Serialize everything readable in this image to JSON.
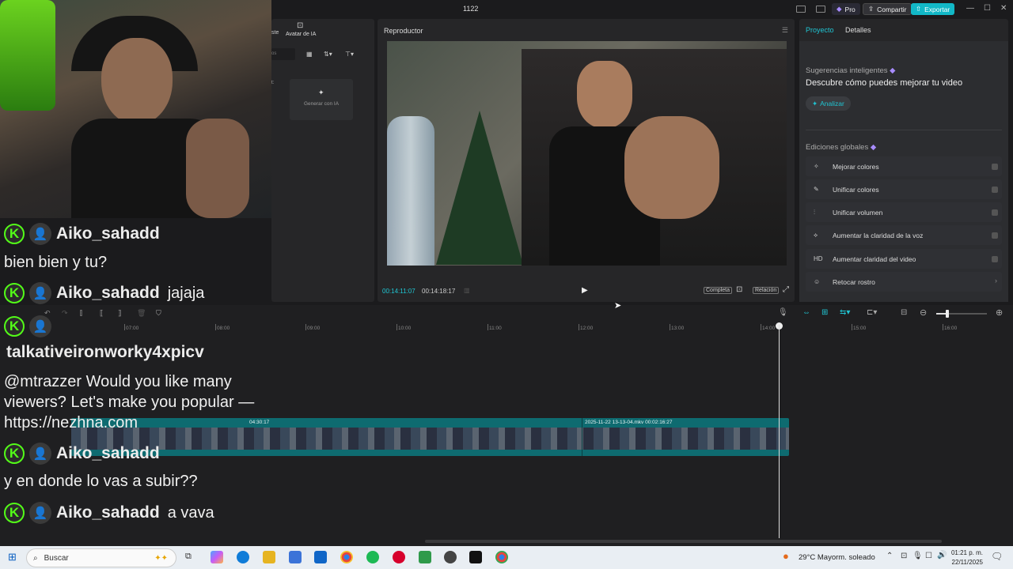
{
  "window": {
    "title": "1122"
  },
  "header": {
    "pro": "Pro",
    "share": "Compartir",
    "export": "Exportar"
  },
  "left_panel": {
    "tab_partial": "ste",
    "tab_avatar": "Avatar de IA",
    "search_partial": "os",
    "label_partial": "t:",
    "generate": "Generar con IA"
  },
  "player": {
    "label": "Reproductor",
    "current_time": "00:14:11:07",
    "total_time": "00:14:18:17",
    "full": "Completa",
    "ratio": "Relación"
  },
  "right_panel": {
    "tab_project": "Proyecto",
    "tab_details": "Detalles",
    "suggestions_label": "Sugerencias inteligentes",
    "suggestions_text": "Descubre cómo puedes mejorar tu video",
    "analyze": "Analizar",
    "global_label": "Ediciones globales",
    "items": [
      {
        "label": "Mejorar colores",
        "icon": "magic-wand-icon"
      },
      {
        "label": "Unificar colores",
        "icon": "color-brush-icon"
      },
      {
        "label": "Unificar volumen",
        "icon": "sliders-icon"
      },
      {
        "label": "Aumentar la claridad de la voz",
        "icon": "voice-icon"
      },
      {
        "label": "Aumentar claridad del video",
        "icon": "hd-icon"
      },
      {
        "label": "Retocar rostro",
        "icon": "face-icon"
      }
    ],
    "hd_text": "HD"
  },
  "timeline": {
    "ticks": [
      "07:00",
      "08:00",
      "09:00",
      "10:00",
      "11:00",
      "12:00",
      "13:00",
      "14:00",
      "15:00",
      "16:00"
    ],
    "clip1_label": "04:30:17",
    "clip2_label": "2025-11-22 13-13-04.mkv   00:02:16:27"
  },
  "chat": [
    {
      "user": "Aiko_sahadd",
      "message": "bien bien y tu?"
    },
    {
      "user": "Aiko_sahadd",
      "inline": "jajaja"
    },
    {
      "user": "talkativeironworky4xpicv",
      "message": "@mtrazzer Would you like many viewers? Let's make you popular — https://nezhna.com"
    },
    {
      "user": "Aiko_sahadd",
      "message": "y en donde lo vas a subir??"
    },
    {
      "user": "Aiko_sahadd",
      "inline": "a vava"
    }
  ],
  "taskbar": {
    "search": "Buscar",
    "weather": "29°C  Mayorm. soleado",
    "time": "01:21 p. m.",
    "date": "22/11/2025"
  }
}
